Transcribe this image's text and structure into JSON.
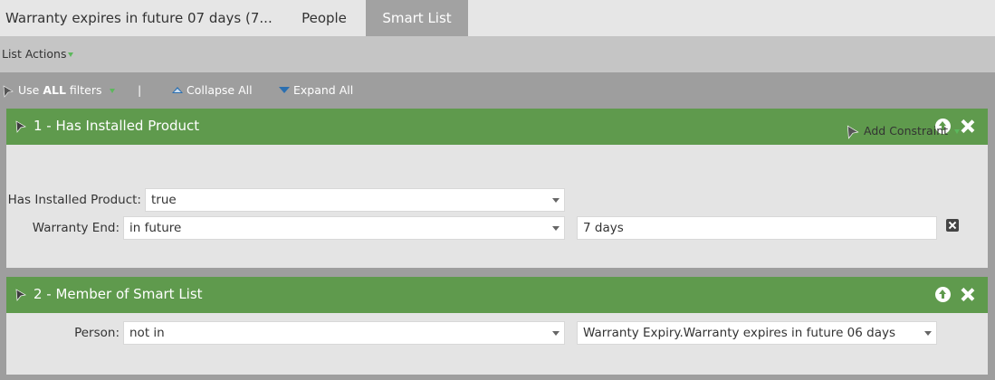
{
  "tabs": [
    {
      "label": "Warranty expires in future 07 days (7..."
    },
    {
      "label": "People"
    },
    {
      "label": "Smart List"
    }
  ],
  "action_bar": {
    "list_actions_label": "List Actions"
  },
  "filter_bar": {
    "use_prefix": "Use ",
    "use_bold": "ALL",
    "use_suffix": " filters",
    "separator": "|",
    "collapse_all_label": "Collapse All",
    "expand_all_label": "Expand All"
  },
  "filters": [
    {
      "title": "1 - Has Installed Product",
      "add_constraint_label": "Add Constraint",
      "rows": [
        {
          "label": "Has Installed Product:",
          "value": "true"
        },
        {
          "label": "Warranty End:",
          "value": "in future",
          "input_value": "7 days"
        }
      ]
    },
    {
      "title": "2 - Member of Smart List",
      "rows": [
        {
          "label": "Person:",
          "value": "not in",
          "value2": "Warranty Expiry.Warranty expires in future 06 days"
        }
      ]
    }
  ],
  "icons": {
    "filter_icon": "filter-pen-icon",
    "move_up_icon": "move-up-icon",
    "remove_icon": "close-icon"
  },
  "colors": {
    "filter_header_green": "#5f9a4d",
    "active_tab": "#a2a2a2",
    "accent_blue": "#2b6fb0"
  }
}
